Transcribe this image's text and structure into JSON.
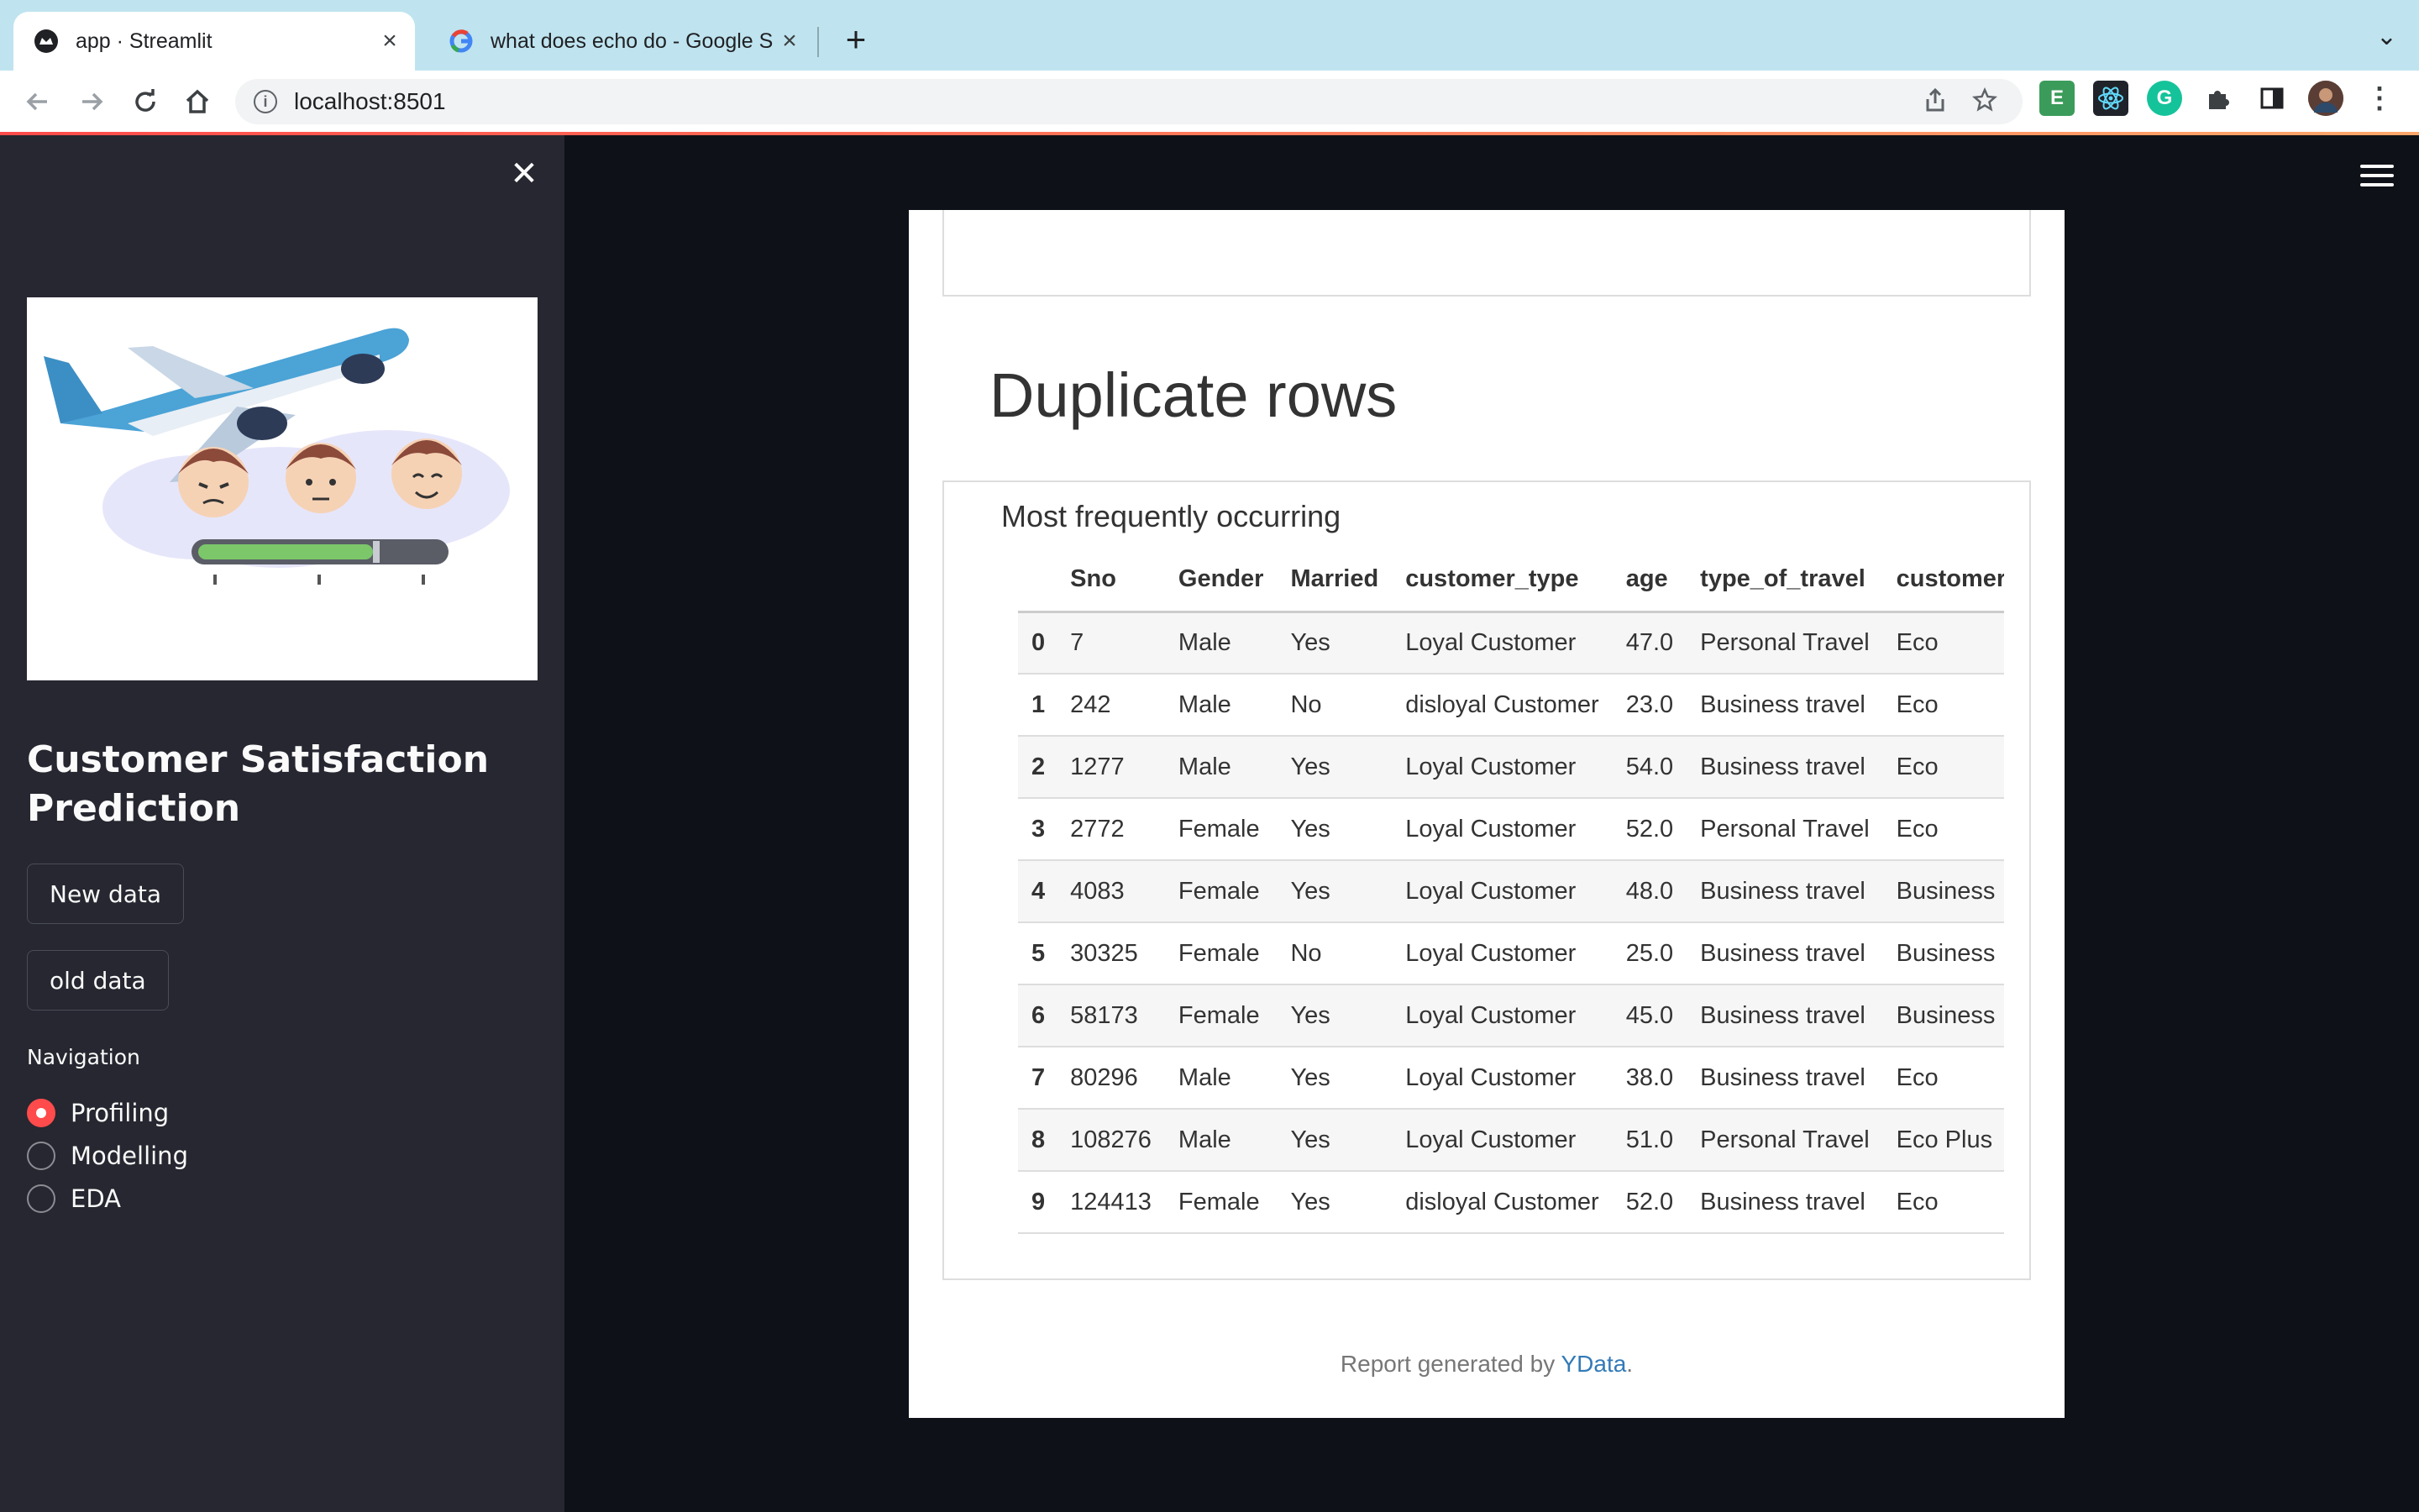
{
  "browser": {
    "tabs": [
      {
        "title": "app · Streamlit",
        "active": true
      },
      {
        "title": "what does echo do - Google Se",
        "active": false
      }
    ],
    "url": "localhost:8501"
  },
  "sidebar": {
    "app_title": "Customer Satisfaction Prediction",
    "buttons": {
      "new_data": "New data",
      "old_data": "old data"
    },
    "nav_label": "Navigation",
    "nav_options": [
      {
        "label": "Profiling",
        "selected": true
      },
      {
        "label": "Modelling",
        "selected": false
      },
      {
        "label": "EDA",
        "selected": false
      }
    ]
  },
  "report": {
    "section_title": "Duplicate rows",
    "caption": "Most frequently occurring",
    "columns": [
      "",
      "Sno",
      "Gender",
      "Married",
      "customer_type",
      "age",
      "type_of_travel",
      "customer_c"
    ],
    "rows": [
      [
        "0",
        "7",
        "Male",
        "Yes",
        "Loyal Customer",
        "47.0",
        "Personal Travel",
        "Eco"
      ],
      [
        "1",
        "242",
        "Male",
        "No",
        "disloyal Customer",
        "23.0",
        "Business travel",
        "Eco"
      ],
      [
        "2",
        "1277",
        "Male",
        "Yes",
        "Loyal Customer",
        "54.0",
        "Business travel",
        "Eco"
      ],
      [
        "3",
        "2772",
        "Female",
        "Yes",
        "Loyal Customer",
        "52.0",
        "Personal Travel",
        "Eco"
      ],
      [
        "4",
        "4083",
        "Female",
        "Yes",
        "Loyal Customer",
        "48.0",
        "Business travel",
        "Business"
      ],
      [
        "5",
        "30325",
        "Female",
        "No",
        "Loyal Customer",
        "25.0",
        "Business travel",
        "Business"
      ],
      [
        "6",
        "58173",
        "Female",
        "Yes",
        "Loyal Customer",
        "45.0",
        "Business travel",
        "Business"
      ],
      [
        "7",
        "80296",
        "Male",
        "Yes",
        "Loyal Customer",
        "38.0",
        "Business travel",
        "Eco"
      ],
      [
        "8",
        "108276",
        "Male",
        "Yes",
        "Loyal Customer",
        "51.0",
        "Personal Travel",
        "Eco Plus"
      ],
      [
        "9",
        "124413",
        "Female",
        "Yes",
        "disloyal Customer",
        "52.0",
        "Business travel",
        "Eco"
      ]
    ],
    "footer_prefix": "Report generated by ",
    "footer_link": "YData",
    "footer_suffix": "."
  },
  "colors": {
    "accent": "#ff4b4b",
    "sidebar_bg": "#262730",
    "main_bg": "#0e1117",
    "link": "#337ab7"
  }
}
